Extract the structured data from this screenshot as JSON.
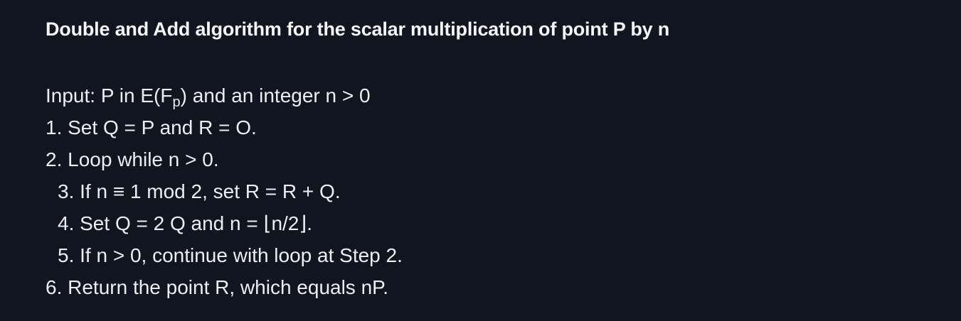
{
  "title": "Double and Add algorithm for the scalar multiplication of point P by n",
  "input": {
    "prefix": "Input: P in E(F",
    "subscript": "p",
    "suffix": ") and an integer n > 0"
  },
  "steps": [
    "1. Set Q = P and R = O.",
    "2. Loop while n > 0.",
    "3. If n ≡ 1 mod 2, set R = R + Q.",
    "4. Set Q = 2 Q and n = ⌊n/2⌋.",
    "5. If n > 0, continue with loop at Step 2.",
    "6. Return the point R, which equals nP."
  ]
}
